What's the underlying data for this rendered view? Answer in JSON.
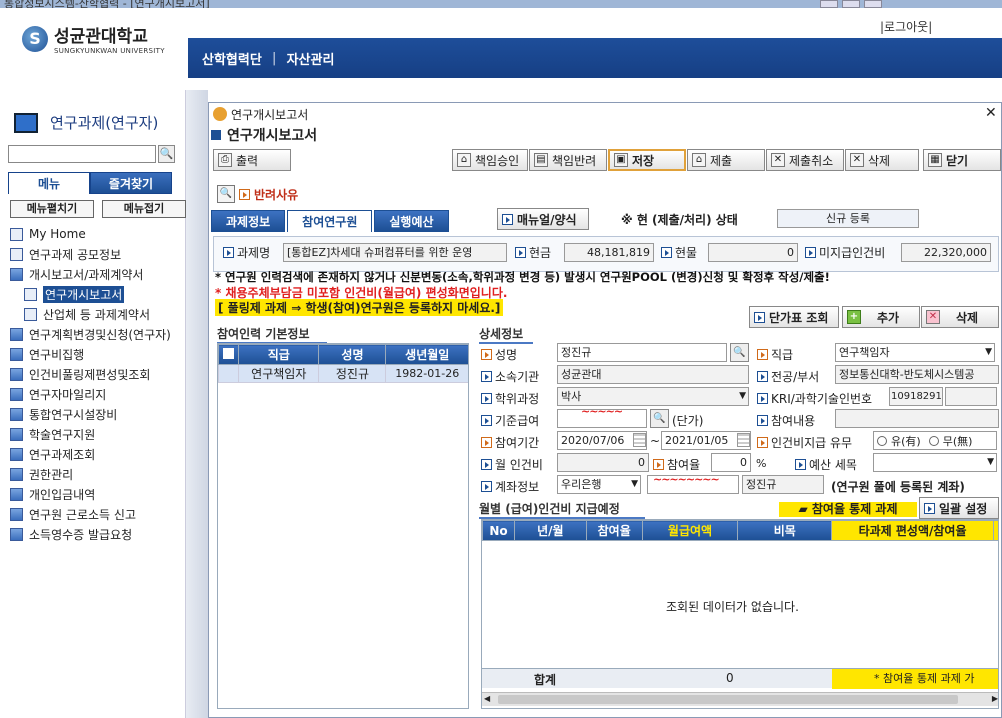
{
  "window": {
    "title": "통합정보시스템-산학협력 - [연구개시보고서]"
  },
  "header": {
    "logo_ko": "성균관대학교",
    "logo_en": "SUNGKYUNKWAN UNIVERSITY",
    "nav": [
      "산학협력단",
      "자산관리"
    ],
    "logout": "로그아웃"
  },
  "sidebar": {
    "title": "연구과제(연구자)",
    "search_placeholder": "",
    "tabs": [
      "메뉴",
      "즐겨찾기"
    ],
    "buttons": [
      "메뉴펼치기",
      "메뉴접기"
    ],
    "items": [
      {
        "label": "My Home",
        "type": "doc",
        "level": 0
      },
      {
        "label": "연구과제 공모정보",
        "type": "doc",
        "level": 0
      },
      {
        "label": "개시보고서/과제계약서",
        "type": "folder-open",
        "level": 0
      },
      {
        "label": "연구개시보고서",
        "type": "doc",
        "level": 1,
        "selected": true
      },
      {
        "label": "산업체 등 과제계약서",
        "type": "doc",
        "level": 1
      },
      {
        "label": "연구계획변경및신청(연구자)",
        "type": "folder",
        "level": 0
      },
      {
        "label": "연구비집행",
        "type": "folder",
        "level": 0
      },
      {
        "label": "인건비풀링제편성및조회",
        "type": "folder",
        "level": 0
      },
      {
        "label": "연구자마일리지",
        "type": "folder",
        "level": 0
      },
      {
        "label": "통합연구시설장비",
        "type": "folder",
        "level": 0
      },
      {
        "label": "학술연구지원",
        "type": "folder",
        "level": 0
      },
      {
        "label": "연구과제조회",
        "type": "folder",
        "level": 0
      },
      {
        "label": "권한관리",
        "type": "folder",
        "level": 0
      },
      {
        "label": "개인입금내역",
        "type": "folder",
        "level": 0
      },
      {
        "label": "연구원 근로소득 신고",
        "type": "folder",
        "level": 0
      },
      {
        "label": "소득영수증 발급요청",
        "type": "folder",
        "level": 0
      }
    ]
  },
  "dialog": {
    "title": "연구개시보고서",
    "heading": "연구개시보고서",
    "print": "출력",
    "toolbar": [
      "책임승인",
      "책임반려",
      "저장",
      "제출",
      "제출취소",
      "삭제",
      "닫기"
    ],
    "reject_reason": "반려사유",
    "tabs": [
      "과제정보",
      "참여연구원",
      "실행예산"
    ],
    "manual": "매뉴얼/양식",
    "status_label": "※ 현 (제출/처리) 상태",
    "status_value": "신규 등록",
    "project_name_label": "과제명",
    "project_name": "[통합EZ]차세대 슈퍼컴퓨터를 위한 운영",
    "cash_label": "현금",
    "cash": "48,181,819",
    "kind_label": "현물",
    "kind": "0",
    "unpaid_label": "미지급인건비",
    "unpaid": "22,320,000",
    "notice1": "* 연구원 인력검색에 존재하지 않거나 신분변동(소속,학위과정 변경 등) 발생시 연구원POOL (변경)신청 및 확정후 작성/제출!",
    "notice2": "* 채용주체부담금 미포함 인건비(월급여) 편성화면입니다.",
    "notice3": "[ 풀링제 과제 ⇒ 학생(참여)연구원은 등록하지 마세요.]",
    "unit_price_btn": "단가표 조회",
    "add_btn": "추가",
    "delete_btn": "삭제",
    "basic_title": "참여인력 기본정보",
    "basic_headers": [
      "직급",
      "성명",
      "생년월일"
    ],
    "basic_rows": [
      [
        "연구책임자",
        "정진규",
        "1982-01-26"
      ]
    ],
    "detail_title": "상세정보",
    "detail": {
      "name_label": "성명",
      "name": "정진규",
      "rank_label": "직급",
      "rank": "연구책임자",
      "org_label": "소속기관",
      "org": "성균관대",
      "major_label": "전공/부서",
      "major": "정보통신대학-반도체시스템공",
      "degree_label": "학위과정",
      "degree": "박사",
      "kri_label": "KRI/과학기술인번호",
      "kri": "10918291",
      "salary_label": "기준급여",
      "salary_unit": "(단가)",
      "part_label": "참여내용",
      "period_label": "참여기간",
      "period_from": "2020/07/06",
      "period_to": "2021/01/05",
      "pay_label": "인건비지급 유무",
      "pay_yes": "유(有)",
      "pay_no": "무(無)",
      "monthly_label": "월 인건비",
      "monthly": "0",
      "rate_label": "참여율",
      "rate": "0",
      "rate_unit": "%",
      "budget_label": "예산 세목",
      "account_label": "계좌정보",
      "bank": "우리은행",
      "holder": "정진규",
      "account_note": "(연구원 풀에 등록된 계좌)"
    },
    "monthly_title": "월별 (급여)인건비 지급예정",
    "control_btn": "참여율 통제 과제",
    "batch_btn": "일괄 설정",
    "monthly_headers": [
      "No",
      "년/월",
      "참여율",
      "월급여액",
      "비목",
      "타과제 편성액/참여율",
      "참"
    ],
    "empty": "조회된 데이터가 없습니다.",
    "total_label": "합계",
    "total": "0",
    "footer_note": "* 참여율 통제 과제 가"
  }
}
